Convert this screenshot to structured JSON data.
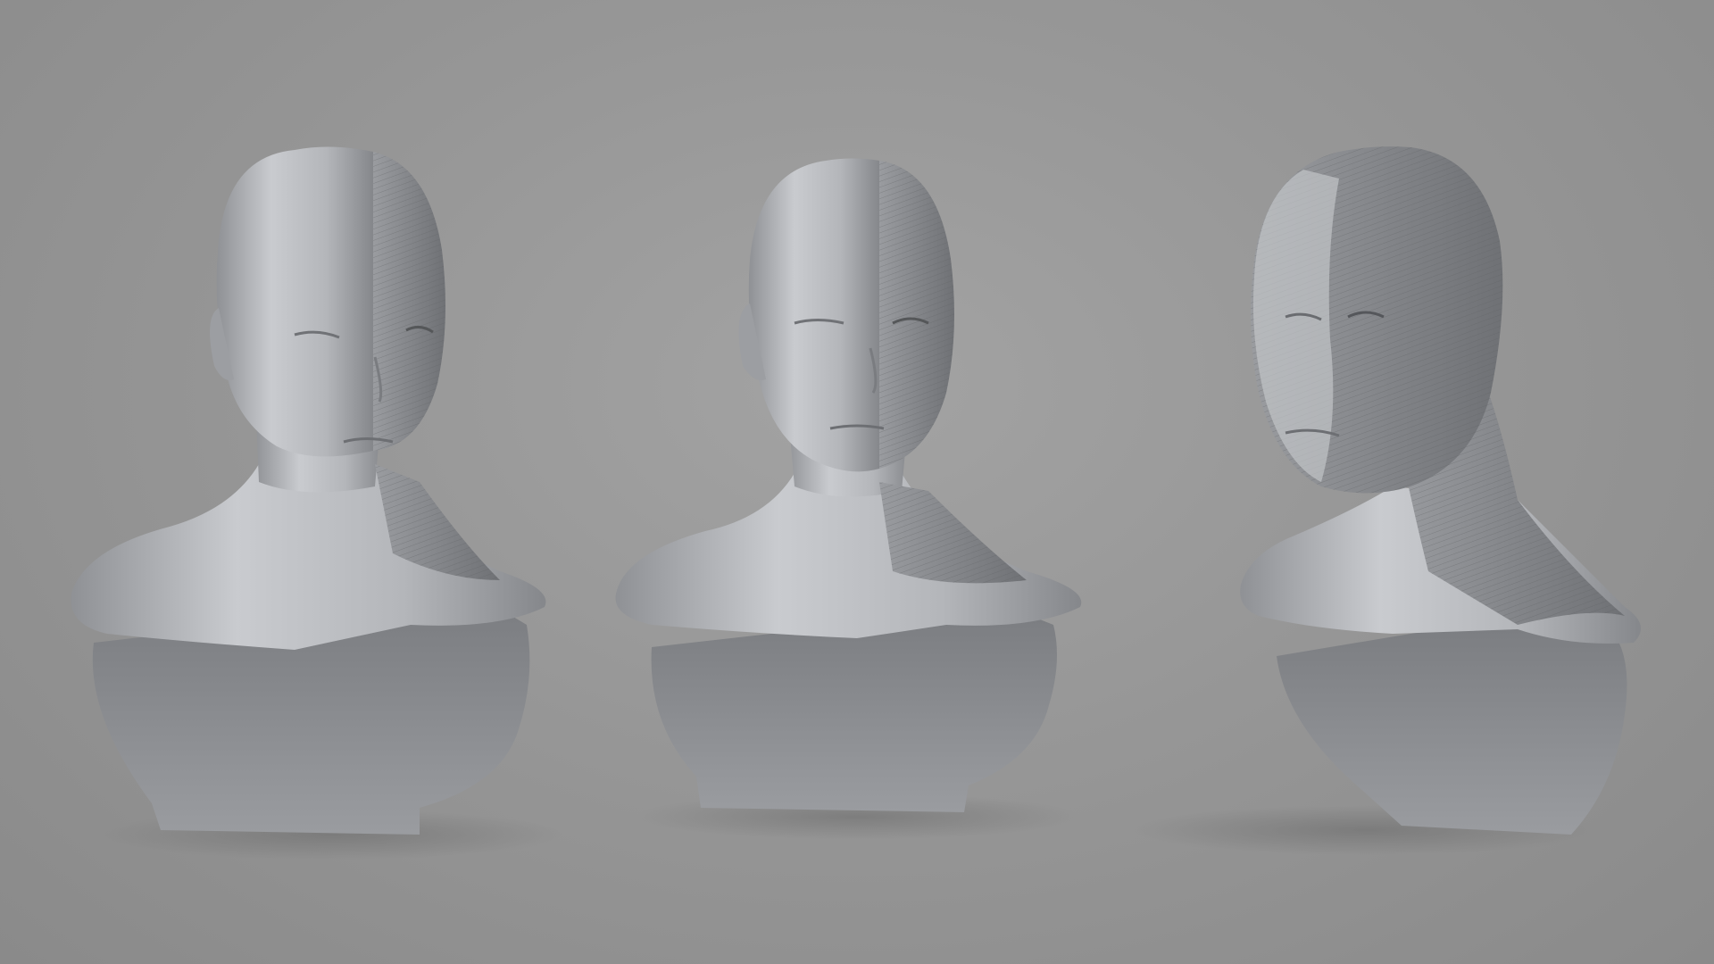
{
  "scene": {
    "background_color": "#979797",
    "material_color": "#b9bbbf",
    "shadow_color": "#6f6f6f",
    "busts": [
      {
        "name": "bust-front-half-skin-half-muscle",
        "view": "front"
      },
      {
        "name": "bust-three-quarter-half-skin-half-muscle",
        "view": "front-three-quarter"
      },
      {
        "name": "bust-three-quarter-full-muscle",
        "view": "left-three-quarter"
      }
    ]
  }
}
